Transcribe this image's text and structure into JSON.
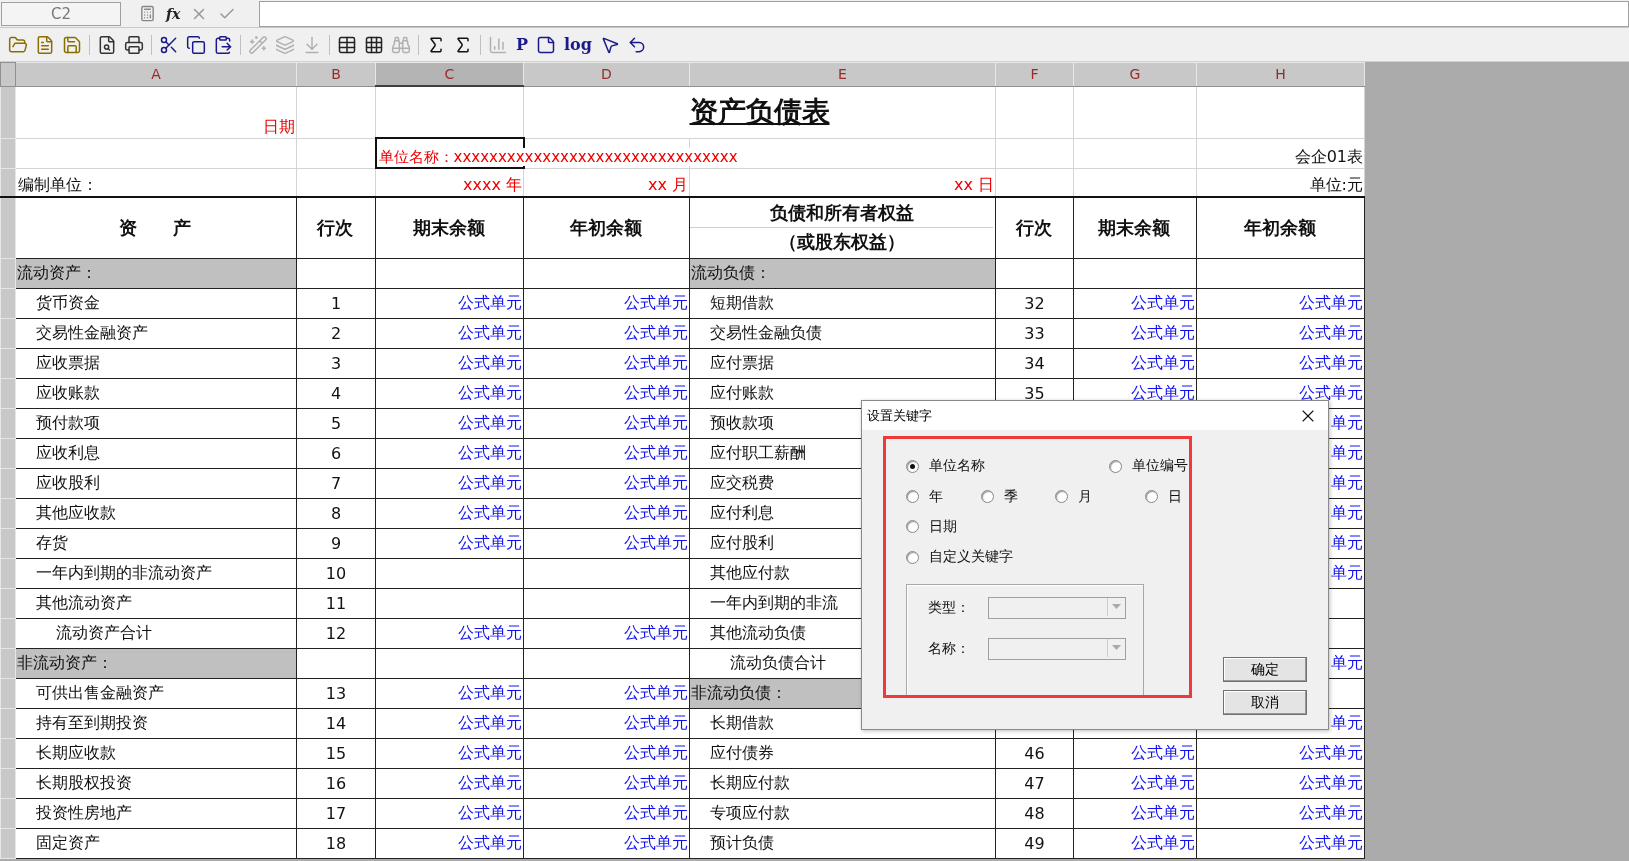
{
  "formula_bar": {
    "cell_ref": "C2",
    "fx": "fx"
  },
  "toolbar": [
    [
      {
        "disabled": false
      },
      {
        "disabled": false
      },
      {
        "disabled": false
      }
    ],
    [
      {
        "disabled": false
      },
      {
        "disabled": false
      }
    ],
    [
      {
        "disabled": false
      },
      {
        "disabled": false
      },
      {
        "disabled": false
      }
    ],
    [
      {
        "disabled": true
      },
      {
        "disabled": true
      },
      {
        "disabled": true
      }
    ],
    [
      {
        "disabled": false
      },
      {
        "disabled": false
      },
      {
        "disabled": true
      }
    ],
    [
      {
        "disabled": false
      },
      {
        "disabled": false
      }
    ],
    [
      {
        "disabled": true
      },
      {
        "disabled": false,
        "label": "P"
      },
      {
        "disabled": false
      },
      {
        "disabled": false,
        "label": "log"
      },
      {
        "disabled": false
      },
      {
        "disabled": false
      }
    ]
  ],
  "columns": [
    {
      "label": "A",
      "selected": false
    },
    {
      "label": "B",
      "selected": false
    },
    {
      "label": "C",
      "selected": true
    },
    {
      "label": "D",
      "selected": false
    },
    {
      "label": "E",
      "selected": false
    },
    {
      "label": "F",
      "selected": false
    },
    {
      "label": "G",
      "selected": false
    },
    {
      "label": "H",
      "selected": false
    }
  ],
  "sheet_header": {
    "date_key": "日期",
    "title": "资产负债表",
    "unit_name": "单位名称：xxxxxxxxxxxxxxxxxxxxxxxxxxxxxxxx",
    "form_code": "会企01表",
    "preparer": "编制单位：",
    "year": "xxxx 年",
    "month": "xx 月",
    "day": "xx 日",
    "currency": "单位:元"
  },
  "headers": [
    [
      "资　　产"
    ],
    [
      "行次"
    ],
    [
      "期末余额"
    ],
    [
      "年初余额"
    ],
    [
      "负债和所有者权益",
      "（或股东权益）"
    ],
    [
      "行次"
    ],
    [
      "期末余额"
    ],
    [
      "年初余额"
    ]
  ],
  "rows": [
    {
      "asset": {
        "kind": "section",
        "label": "流动资产："
      },
      "liability": {
        "kind": "section",
        "label": "流动负债："
      }
    },
    {
      "asset": {
        "kind": "item",
        "label": "货币资金",
        "line": "1",
        "closing": "公式单元",
        "opening": "公式单元"
      },
      "liability": {
        "kind": "item",
        "label": "短期借款",
        "line": "32",
        "closing": "公式单元",
        "opening": "公式单元"
      }
    },
    {
      "asset": {
        "kind": "item",
        "label": "交易性金融资产",
        "line": "2",
        "closing": "公式单元",
        "opening": "公式单元"
      },
      "liability": {
        "kind": "item",
        "label": "交易性金融负债",
        "line": "33",
        "closing": "公式单元",
        "opening": "公式单元"
      }
    },
    {
      "asset": {
        "kind": "item",
        "label": "应收票据",
        "line": "3",
        "closing": "公式单元",
        "opening": "公式单元"
      },
      "liability": {
        "kind": "item",
        "label": "应付票据",
        "line": "34",
        "closing": "公式单元",
        "opening": "公式单元"
      }
    },
    {
      "asset": {
        "kind": "item",
        "label": "应收账款",
        "line": "4",
        "closing": "公式单元",
        "opening": "公式单元"
      },
      "liability": {
        "kind": "item",
        "label": "应付账款",
        "line": "35",
        "closing": "公式单元",
        "opening": "公式单元"
      }
    },
    {
      "asset": {
        "kind": "item",
        "label": "预付款项",
        "line": "5",
        "closing": "公式单元",
        "opening": "公式单元"
      },
      "liability": {
        "kind": "item",
        "label": "预收款项",
        "opening": "单元"
      }
    },
    {
      "asset": {
        "kind": "item",
        "label": "应收利息",
        "line": "6",
        "closing": "公式单元",
        "opening": "公式单元"
      },
      "liability": {
        "kind": "item",
        "label": "应付职工薪酬",
        "opening": "单元"
      }
    },
    {
      "asset": {
        "kind": "item",
        "label": "应收股利",
        "line": "7",
        "closing": "公式单元",
        "opening": "公式单元"
      },
      "liability": {
        "kind": "item",
        "label": "应交税费",
        "opening": "单元"
      }
    },
    {
      "asset": {
        "kind": "item",
        "label": "其他应收款",
        "line": "8",
        "closing": "公式单元",
        "opening": "公式单元"
      },
      "liability": {
        "kind": "item",
        "label": "应付利息",
        "opening": "单元"
      }
    },
    {
      "asset": {
        "kind": "item",
        "label": "存货",
        "line": "9",
        "closing": "公式单元",
        "opening": "公式单元"
      },
      "liability": {
        "kind": "item",
        "label": "应付股利",
        "opening": "单元"
      }
    },
    {
      "asset": {
        "kind": "item",
        "label": "一年内到期的非流动资产",
        "line": "10"
      },
      "liability": {
        "kind": "item",
        "label": "其他应付款",
        "opening": "单元"
      }
    },
    {
      "asset": {
        "kind": "item",
        "label": "其他流动资产",
        "line": "11"
      },
      "liability": {
        "kind": "item",
        "label": "一年内到期的非流"
      }
    },
    {
      "asset": {
        "kind": "total",
        "label": "流动资产合计",
        "line": "12",
        "closing": "公式单元",
        "opening": "公式单元"
      },
      "liability": {
        "kind": "item",
        "label": "其他流动负债"
      }
    },
    {
      "asset": {
        "kind": "section",
        "label": "非流动资产："
      },
      "liability": {
        "kind": "total",
        "label": "流动负债合计",
        "opening": "单元"
      }
    },
    {
      "asset": {
        "kind": "item",
        "label": "可供出售金融资产",
        "line": "13",
        "closing": "公式单元",
        "opening": "公式单元"
      },
      "liability": {
        "kind": "section",
        "label": "非流动负债："
      }
    },
    {
      "asset": {
        "kind": "item",
        "label": "持有至到期投资",
        "line": "14",
        "closing": "公式单元",
        "opening": "公式单元"
      },
      "liability": {
        "kind": "item",
        "label": "长期借款",
        "opening": "单元"
      }
    },
    {
      "asset": {
        "kind": "item",
        "label": "长期应收款",
        "line": "15",
        "closing": "公式单元",
        "opening": "公式单元"
      },
      "liability": {
        "kind": "item",
        "label": "应付债券",
        "line": "46",
        "closing": "公式单元",
        "opening": "公式单元"
      }
    },
    {
      "asset": {
        "kind": "item",
        "label": "长期股权投资",
        "line": "16",
        "closing": "公式单元",
        "opening": "公式单元"
      },
      "liability": {
        "kind": "item",
        "label": "长期应付款",
        "line": "47",
        "closing": "公式单元",
        "opening": "公式单元"
      }
    },
    {
      "asset": {
        "kind": "item",
        "label": "投资性房地产",
        "line": "17",
        "closing": "公式单元",
        "opening": "公式单元"
      },
      "liability": {
        "kind": "item",
        "label": "专项应付款",
        "line": "48",
        "closing": "公式单元",
        "opening": "公式单元"
      }
    },
    {
      "asset": {
        "kind": "item",
        "label": "固定资产",
        "line": "18",
        "closing": "公式单元",
        "opening": "公式单元"
      },
      "liability": {
        "kind": "item",
        "label": "预计负债",
        "line": "49",
        "closing": "公式单元",
        "opening": "公式单元"
      }
    }
  ],
  "dialog": {
    "title": "设置关键字",
    "option_rows": [
      [
        {
          "label": "单位名称",
          "selected": true
        },
        {
          "label": "单位编号",
          "selected": false
        }
      ],
      [
        {
          "label": "年",
          "selected": false
        },
        {
          "label": "季",
          "selected": false
        },
        {
          "label": "月",
          "selected": false
        },
        {
          "label": "日",
          "selected": false
        }
      ],
      [
        {
          "label": "日期",
          "selected": false
        }
      ],
      [
        {
          "label": "自定义关键字",
          "selected": false
        }
      ]
    ],
    "fields": [
      {
        "label": "类型：",
        "disabled": true
      },
      {
        "label": "名称：",
        "disabled": true
      }
    ],
    "buttons": [
      "确定",
      "取消"
    ]
  }
}
